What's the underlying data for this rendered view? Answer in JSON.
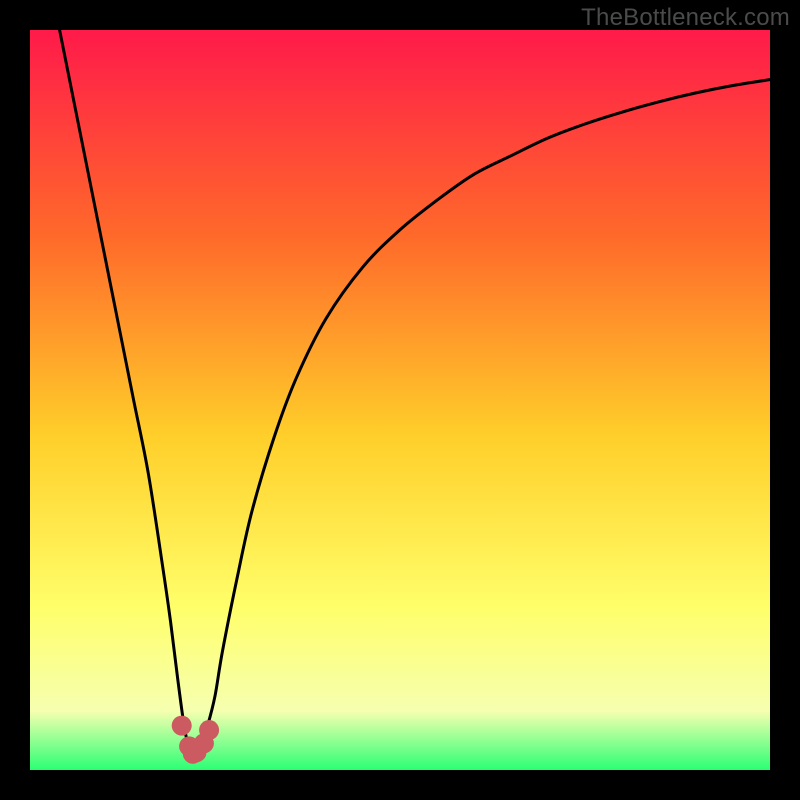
{
  "watermark": "TheBottleneck.com",
  "colors": {
    "frame": "#000000",
    "gradient_top": "#ff1a4a",
    "gradient_mid_upper": "#ff6a2a",
    "gradient_mid": "#ffcf2a",
    "gradient_mid_lower": "#ffff6a",
    "gradient_lower": "#f6ffb0",
    "gradient_bottom": "#2bff74",
    "curve": "#000000",
    "marker_fill": "#cc5a61",
    "marker_stroke": "#cc5a61"
  },
  "chart_data": {
    "type": "line",
    "title": "",
    "xlabel": "",
    "ylabel": "",
    "xlim": [
      0,
      100
    ],
    "ylim": [
      0,
      100
    ],
    "optimum_x": 22,
    "series": [
      {
        "name": "bottleneck-curve",
        "x": [
          4,
          6,
          8,
          10,
          12,
          14,
          16,
          18,
          19,
          20,
          21,
          22,
          23,
          24,
          25,
          26,
          28,
          30,
          33,
          36,
          40,
          45,
          50,
          55,
          60,
          65,
          70,
          75,
          80,
          85,
          90,
          95,
          100
        ],
        "y": [
          100,
          90,
          80,
          70,
          60,
          50,
          40,
          27,
          20,
          12,
          5,
          2,
          3,
          6,
          10,
          16,
          26,
          35,
          45,
          53,
          61,
          68,
          73,
          77,
          80.5,
          83,
          85.4,
          87.3,
          88.9,
          90.3,
          91.5,
          92.5,
          93.3
        ]
      }
    ],
    "markers": {
      "name": "optimum-markers",
      "x": [
        20.5,
        21.5,
        22.0,
        22.5,
        23.5,
        24.2
      ],
      "y": [
        6.0,
        3.2,
        2.2,
        2.4,
        3.6,
        5.4
      ]
    }
  }
}
